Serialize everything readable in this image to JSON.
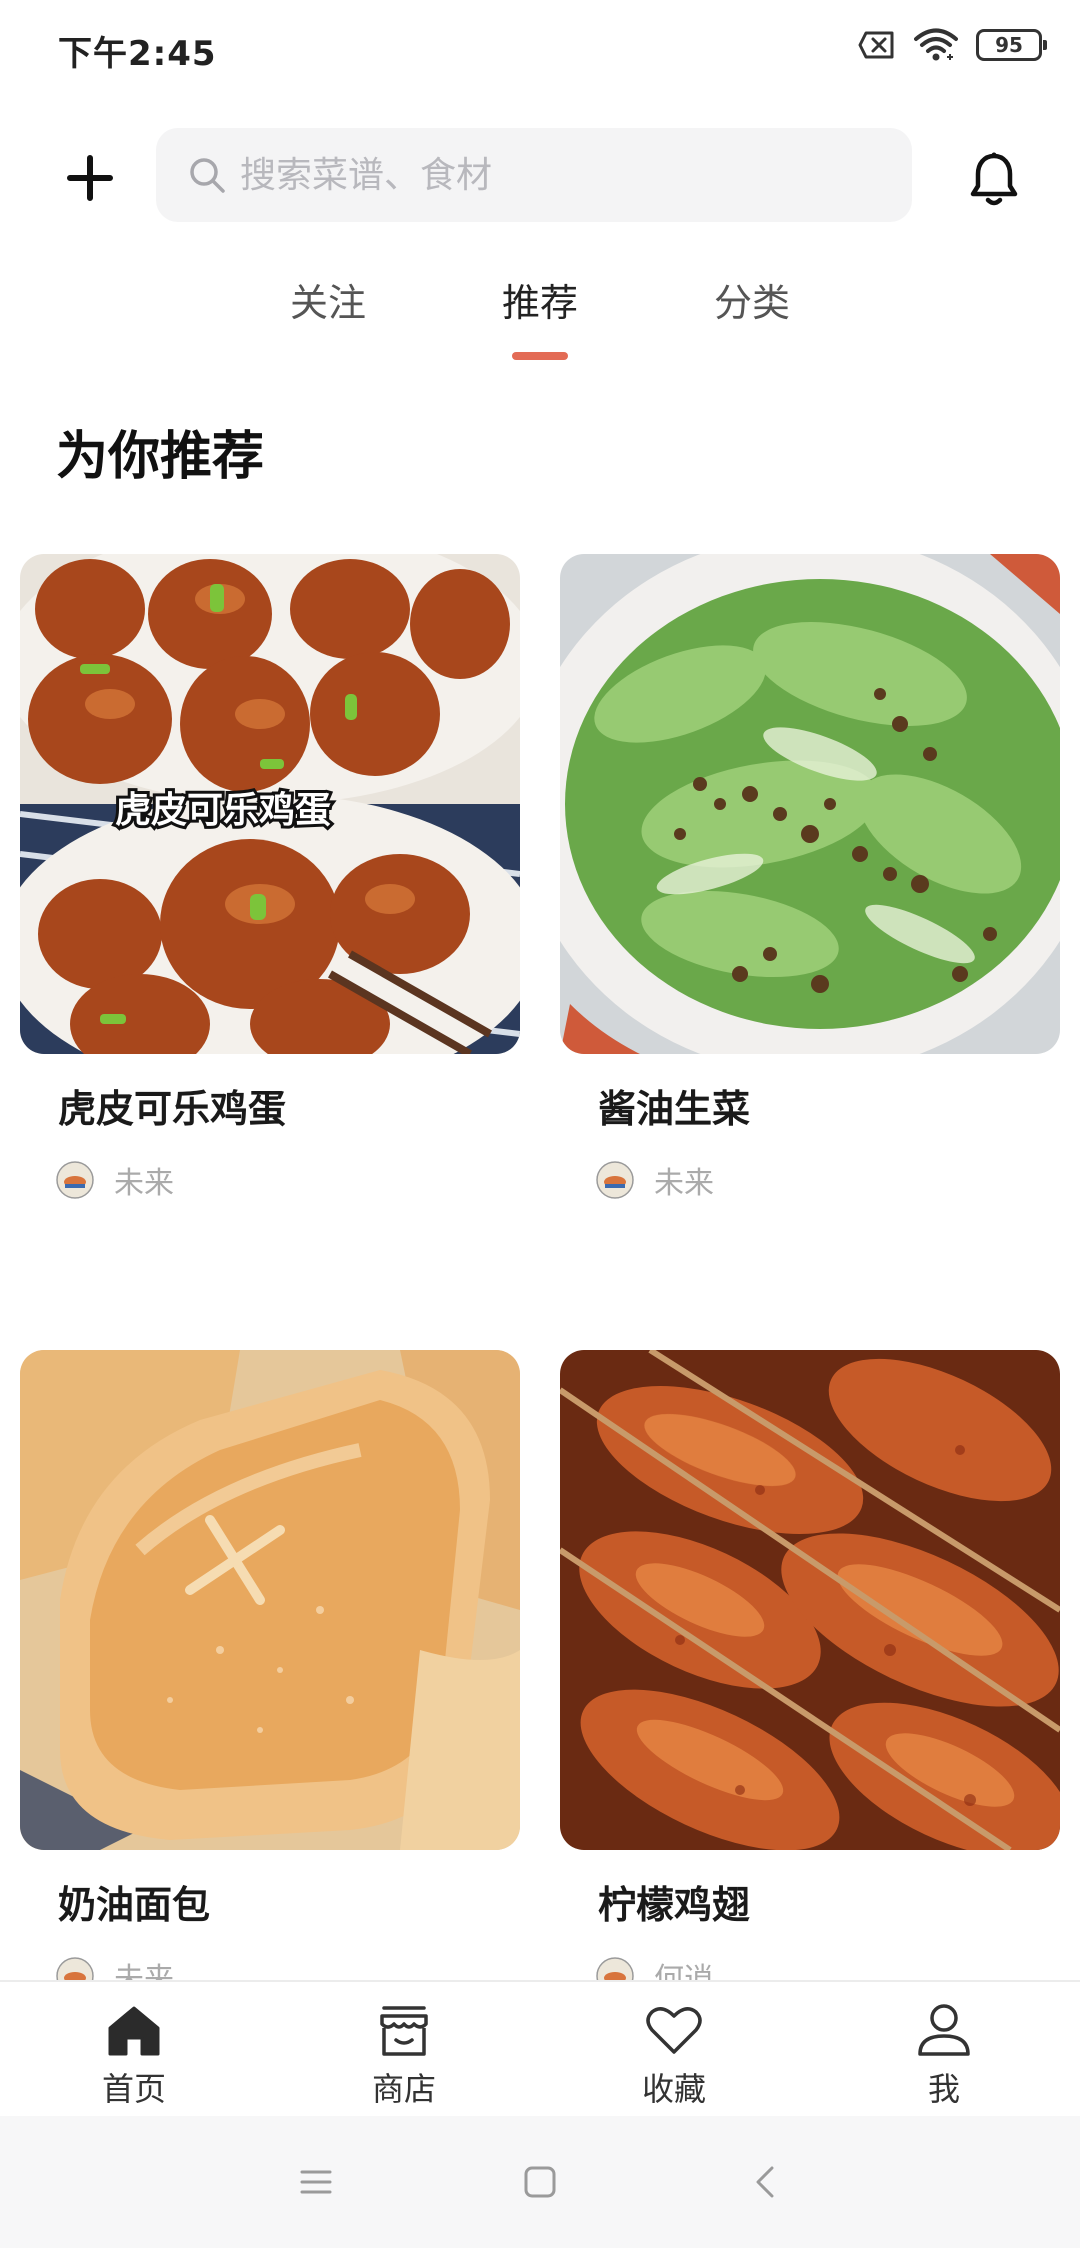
{
  "status_bar": {
    "time": "下午2:45",
    "battery": "95",
    "icons": [
      "sim-off-icon",
      "wifi-icon",
      "battery-icon"
    ]
  },
  "header": {
    "search_placeholder": "搜索菜谱、食材",
    "icons": [
      "plus-icon",
      "search-icon",
      "bell-icon"
    ]
  },
  "tabs": [
    {
      "label": "关注",
      "active": false
    },
    {
      "label": "推荐",
      "active": true
    },
    {
      "label": "分类",
      "active": false
    }
  ],
  "colors": {
    "accent": "#e36b55",
    "muted_text": "#aaaaaa",
    "search_bg": "#f4f4f5"
  },
  "section_title": "为你推荐",
  "recipes": [
    {
      "title": "虎皮可乐鸡蛋",
      "author": "未来",
      "image_caption": "虎皮可乐鸡蛋",
      "image": "braised-eggs-photo"
    },
    {
      "title": "酱油生菜",
      "author": "未来",
      "image": "lettuce-soy-sauce-photo"
    },
    {
      "title": "奶油面包",
      "author": "未来",
      "image": "cream-bread-photo"
    },
    {
      "title": "柠檬鸡翅",
      "author": "何逍",
      "image": "lemon-chicken-wings-photo"
    }
  ],
  "bottom_nav": [
    {
      "label": "首页",
      "icon": "home-icon",
      "active": true
    },
    {
      "label": "商店",
      "icon": "shop-icon",
      "active": false
    },
    {
      "label": "收藏",
      "icon": "heart-icon",
      "active": false
    },
    {
      "label": "我",
      "icon": "user-icon",
      "active": false
    }
  ],
  "system_nav": [
    "menu-icon",
    "home-square-icon",
    "back-icon"
  ]
}
